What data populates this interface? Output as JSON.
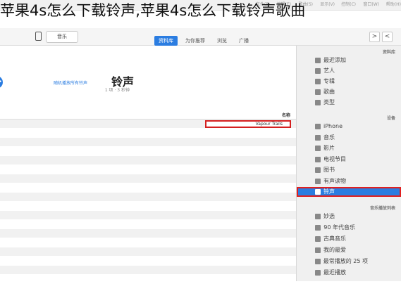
{
  "overlay_title": "苹果4s怎么下载铃声,苹果4s怎么下载铃声歌曲",
  "menubar": [
    "帮助(H)",
    "窗口(W)",
    "控制(C)",
    "显示(V)",
    "歌曲(S)",
    "编辑(E)",
    "文件(F)"
  ],
  "toolbar": {
    "back": "<",
    "forward": ">",
    "device": "音乐",
    "tabs": [
      {
        "label": "资料库",
        "active": true
      },
      {
        "label": "为你推荐",
        "active": false
      },
      {
        "label": "浏览",
        "active": false
      },
      {
        "label": "广播",
        "active": false
      }
    ]
  },
  "sidebar": {
    "library_header": "资料库",
    "library": [
      "最近添加",
      "艺人",
      "专辑",
      "歌曲",
      "类型"
    ],
    "devices_header": "设备",
    "device_name": "iPhone",
    "device_items": [
      "音乐",
      "影片",
      "电视节目",
      "图书",
      "有声读物",
      "铃声"
    ],
    "selected": "铃声",
    "playlists_header": "音乐播放列表",
    "playlists": [
      "妙选",
      "90 年代音乐",
      "古典音乐",
      "我的最爱",
      "最常播放的 25 项",
      "最近播放"
    ]
  },
  "main": {
    "title": "铃声",
    "subtitle": "1 项 · 3 秒钟",
    "action_text": "随机播放所有铃声",
    "action_icon": "shuffle-icon",
    "column_header": "名称",
    "song": "Vapour Trails"
  },
  "colors": {
    "accent": "#2b7de1",
    "highlight": "#d42020"
  }
}
